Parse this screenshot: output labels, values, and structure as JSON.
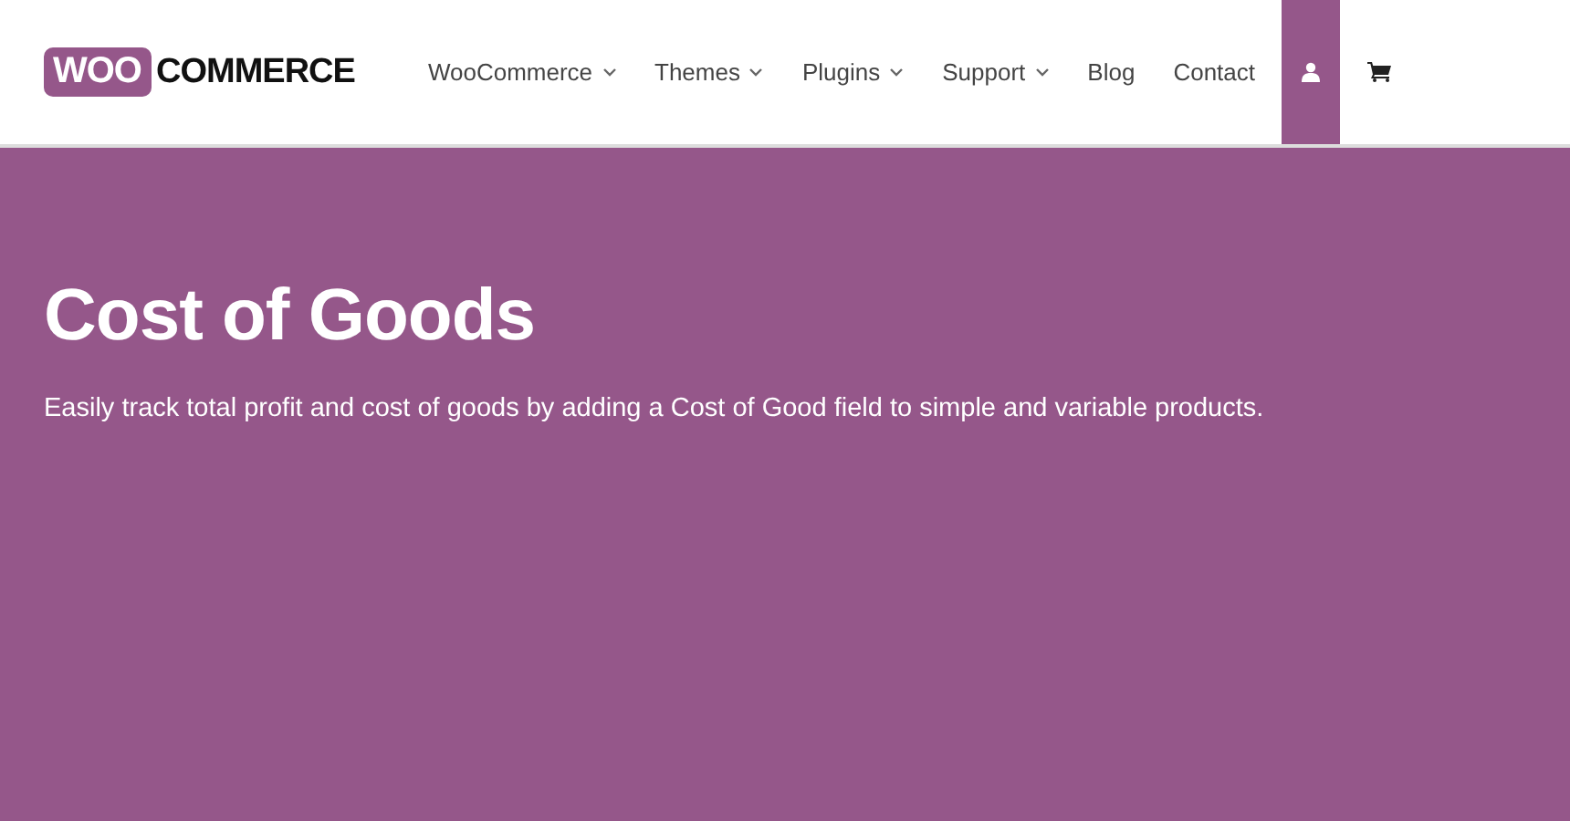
{
  "header": {
    "logo": {
      "badge": "WOO",
      "wordmark": "COMMERCE"
    },
    "nav": [
      {
        "label": "WooCommerce",
        "dropdown": true
      },
      {
        "label": "Themes",
        "dropdown": true
      },
      {
        "label": "Plugins",
        "dropdown": true
      },
      {
        "label": "Support",
        "dropdown": true
      },
      {
        "label": "Blog",
        "dropdown": false
      },
      {
        "label": "Contact",
        "dropdown": false
      }
    ],
    "icons": [
      {
        "kind": "account",
        "selected": true
      },
      {
        "kind": "cart",
        "selected": false
      }
    ]
  },
  "hero": {
    "title": "Cost of Goods",
    "subtitle": "Easily track total profit and cost of goods by adding a Cost of Good field to simple and variable products."
  }
}
